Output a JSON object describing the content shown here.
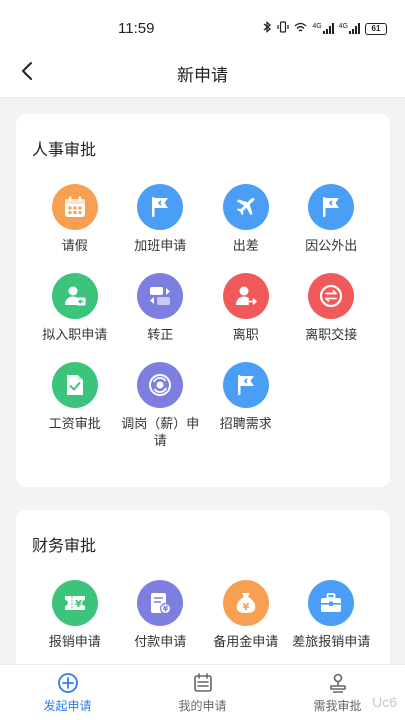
{
  "status": {
    "time": "11:59",
    "net1": "4G",
    "net2": "4G",
    "battery": "61"
  },
  "nav": {
    "title": "新申请"
  },
  "sections": [
    {
      "title": "人事审批",
      "items": [
        {
          "label": "请假",
          "icon": "calendar-icon",
          "color": "#f7a052"
        },
        {
          "label": "加班申请",
          "icon": "flag-icon",
          "color": "#4a9ef5"
        },
        {
          "label": "出差",
          "icon": "airplane-icon",
          "color": "#4a9ef5"
        },
        {
          "label": "因公外出",
          "icon": "flag-icon",
          "color": "#4a9ef5"
        },
        {
          "label": "拟入职申请",
          "icon": "user-arrow-icon",
          "color": "#3cc47c"
        },
        {
          "label": "转正",
          "icon": "swap-icon",
          "color": "#7d7fe0"
        },
        {
          "label": "离职",
          "icon": "user-exit-icon",
          "color": "#f05a5a"
        },
        {
          "label": "离职交接",
          "icon": "exchange-icon",
          "color": "#f05a5a"
        },
        {
          "label": "工资审批",
          "icon": "document-check-icon",
          "color": "#3cc47c"
        },
        {
          "label": "调岗（薪）申请",
          "icon": "refresh-icon",
          "color": "#7d7fe0"
        },
        {
          "label": "招聘需求",
          "icon": "flag-icon",
          "color": "#4a9ef5"
        }
      ]
    },
    {
      "title": "财务审批",
      "items": [
        {
          "label": "报销申请",
          "icon": "ticket-yen-icon",
          "color": "#3cc47c"
        },
        {
          "label": "付款申请",
          "icon": "invoice-yen-icon",
          "color": "#7d7fe0"
        },
        {
          "label": "备用金申请",
          "icon": "money-bag-icon",
          "color": "#f7a052"
        },
        {
          "label": "差旅报销申请",
          "icon": "briefcase-icon",
          "color": "#4a9ef5"
        }
      ]
    }
  ],
  "tabs": [
    {
      "label": "发起申请",
      "icon": "plus-circle-icon",
      "active": true
    },
    {
      "label": "我的申请",
      "icon": "calendar-list-icon",
      "active": false
    },
    {
      "label": "需我审批",
      "icon": "stamp-icon",
      "active": false
    }
  ],
  "accent": "#2b7de9",
  "watermark": "Uc6"
}
